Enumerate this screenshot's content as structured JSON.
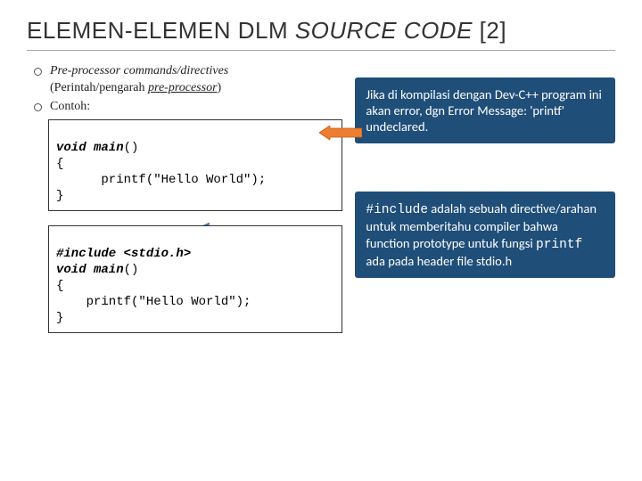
{
  "title": {
    "pre": "ELEMEN-ELEMEN DLM ",
    "italic": "SOURCE CODE",
    "suffix": " [2]"
  },
  "bullet1": {
    "em": "Pre-processor commands/directives",
    "plain_open": "(Perintah/pengarah ",
    "underline": "pre-processor",
    "plain_close": ")"
  },
  "bullet2": "Contoh:",
  "code1": {
    "l1a": "void main",
    "l1b": "()",
    "l2": "{",
    "l3": "      printf(\"Hello World\");",
    "l4": "}"
  },
  "code2": {
    "l1a": "#include",
    "l1b": " <stdio.h>",
    "l2a": "void main",
    "l2b": "()",
    "l3": "{",
    "l4": "    printf(\"Hello World\");",
    "l5": "}"
  },
  "callout1": {
    "text": "Jika di kompilasi dengan Dev-C++ program ini akan error, dgn Error Message: 'printf' undeclared."
  },
  "callout2": {
    "pre": "#include",
    "mid": " adalah sebuah directive/arahan untuk memberitahu compiler bahwa function prototype untuk fungsi ",
    "code": "printf",
    "post": " ada pada header file stdio.h"
  }
}
